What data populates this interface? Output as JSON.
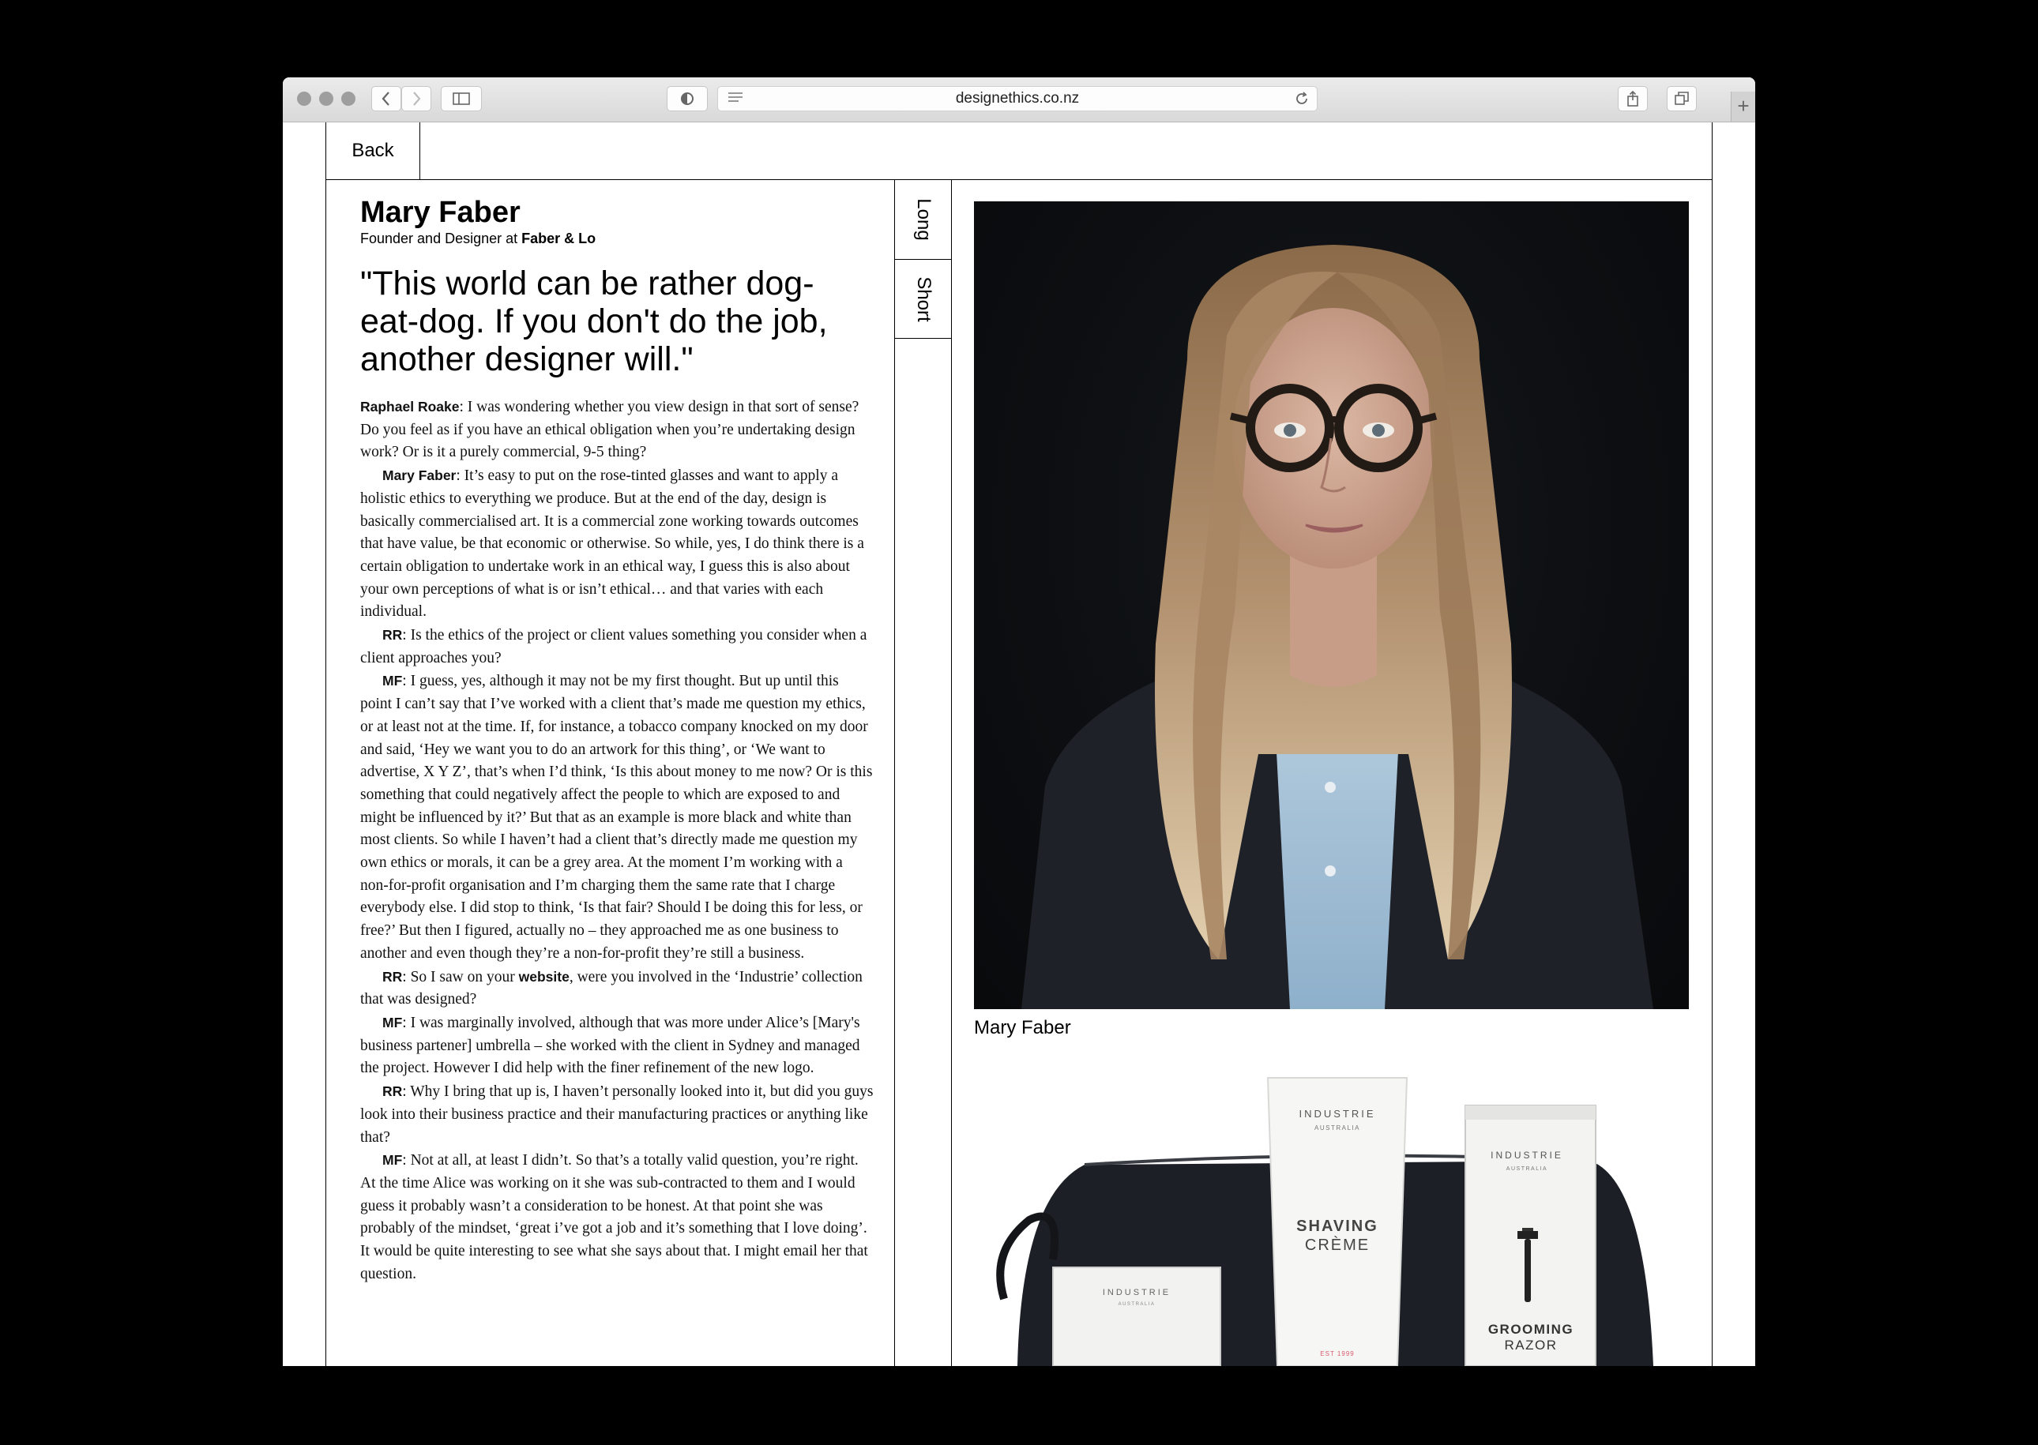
{
  "browser": {
    "url": "designethics.co.nz"
  },
  "nav": {
    "back_label": "Back"
  },
  "view_tabs": {
    "long_label": "Long",
    "short_label": "Short"
  },
  "profile": {
    "name": "Mary Faber",
    "role_prefix": "Founder and Designer at",
    "company": "Faber & Lo",
    "quote": "\"This world can be rather dog-eat-dog. If you don't do the job, another designer will.\""
  },
  "interview": [
    {
      "speaker": "Raphael Roake",
      "text": ": I was wondering whether you view design in that sort of sense? Do you feel as if you have an ethical obligation when you’re undertaking design work? Or is it a purely commercial, 9-5 thing?"
    },
    {
      "speaker": "Mary Faber",
      "text": ": It’s easy to put on the rose-tinted glasses and want to apply a holistic ethics to everything we produce. But at the end of the day, design is basically commercialised art. It is a commercial zone working towards outcomes that have value, be that economic or otherwise. So while, yes, I do think there is a certain obligation to undertake work in an ethical way, I guess this is also about your own perceptions of what is or isn’t ethical… and that varies with each individual."
    },
    {
      "speaker": "RR",
      "text": ": Is the ethics of the project or client values something you consider when a client approaches you?"
    },
    {
      "speaker": "MF",
      "text": ": I guess, yes, although it may not be my first thought. But up until this point I can’t say that I’ve worked with a client that’s made me question my ethics, or at least not at the time. If, for instance, a tobacco company knocked on my door and said, ‘Hey we want you to do an artwork for this thing’, or ‘We want to advertise, X Y Z’, that’s when I’d think, ‘Is this about money to me now? Or is this something that could negatively affect the people to which are exposed to and might be influenced by it?’ But that as an example is more black and white than most clients. So while I haven’t had a client that’s directly made me question my own ethics or morals, it can be a grey area. At the moment I’m working with a non-for-profit organisation and I’m charging them the same rate that I charge everybody else. I did stop to think, ‘Is that fair? Should I be doing this for less, or free?’ But then I figured, actually no – they approached me as one business to another and even though they’re a non-for-profit they’re still a business."
    },
    {
      "speaker": "RR",
      "text_before": ": So I saw on your ",
      "link": "website",
      "text": ", were you involved in the ‘Industrie’ collection that was designed?"
    },
    {
      "speaker": "MF",
      "text": ": I was marginally involved, although that was more under Alice’s [Mary's business partener] umbrella – she worked with the client in Sydney and managed the project. However I did help with the finer refinement of the new logo."
    },
    {
      "speaker": "RR",
      "text": ": Why I bring that up is, I haven’t personally looked into it, but did you guys look into their business practice and their manufacturing practices or anything like that?"
    },
    {
      "speaker": "MF",
      "text": ": Not at all, at least I didn’t. So that’s a totally valid question, you’re right. At the time Alice was working on it she was sub-contracted to them and I would guess it probably wasn’t a consideration to be honest. At that point she was probably of the mindset, ‘great i’ve got a job and it’s something that I love doing’. It would be quite interesting to see what she says about that. I might email her that question."
    }
  ],
  "photo": {
    "caption": "Mary Faber"
  },
  "product": {
    "brand": "INDUSTRIE",
    "country": "AUSTRALIA",
    "tube_line1": "SHAVING",
    "tube_line2": "CRÈME",
    "tube_est": "EST 1999",
    "box_line1": "GROOMING",
    "box_line2": "RAZOR",
    "tm": "™"
  }
}
